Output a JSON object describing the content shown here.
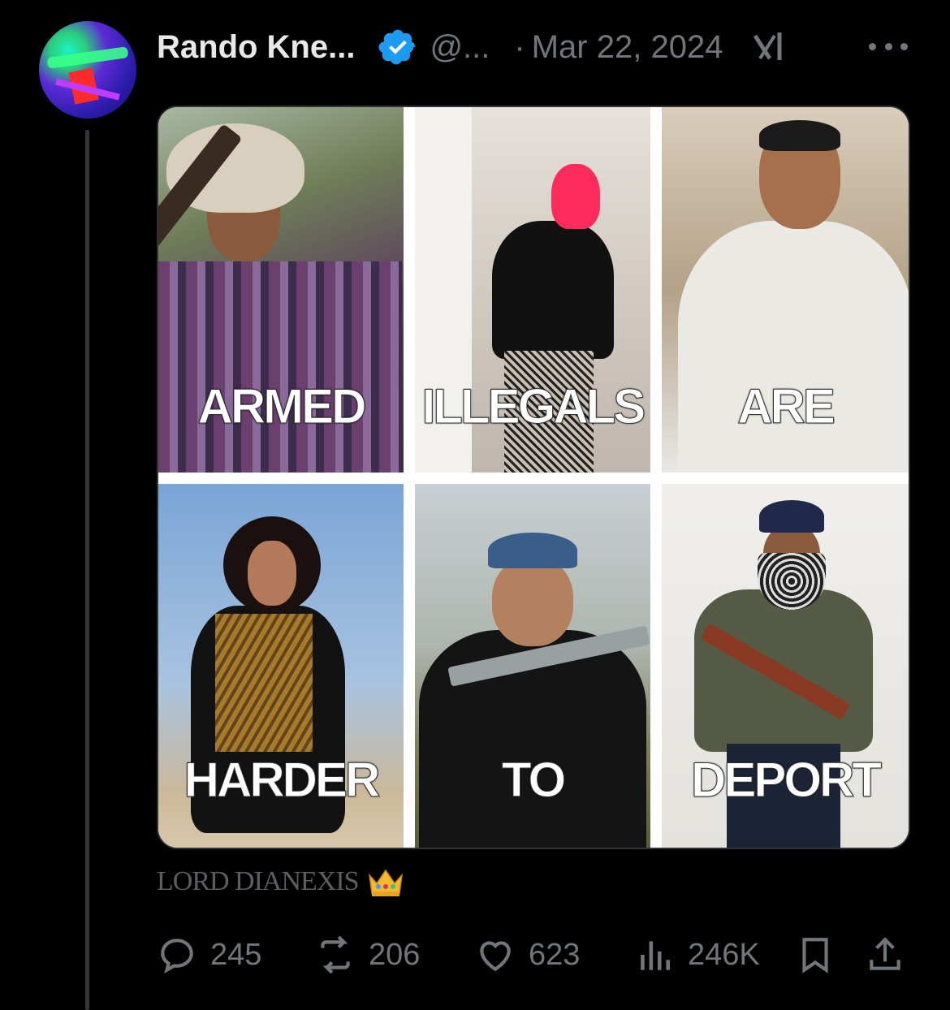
{
  "post": {
    "author_name": "Rando Kne...",
    "handle": "@...",
    "separator": "·",
    "date": "Mar 22, 2024"
  },
  "media": {
    "captions": [
      "ARMED",
      "ILLEGALS",
      "ARE",
      "HARDER",
      "TO",
      "DEPORT"
    ]
  },
  "watermark": {
    "text": "LORD DIANEXIS",
    "emoji": "👑"
  },
  "metrics": {
    "replies": "245",
    "reposts": "206",
    "likes": "623",
    "views": "246K"
  },
  "colors": {
    "background": "#000000",
    "text_primary": "#e7e9ea",
    "text_secondary": "#71767b",
    "verified_blue": "#1d9bf0",
    "thread_line": "#333639"
  },
  "icons": [
    "verified-badge-icon",
    "grok-icon",
    "more-icon",
    "reply-icon",
    "repost-icon",
    "like-icon",
    "views-icon",
    "bookmark-icon",
    "share-icon",
    "crown-icon"
  ]
}
